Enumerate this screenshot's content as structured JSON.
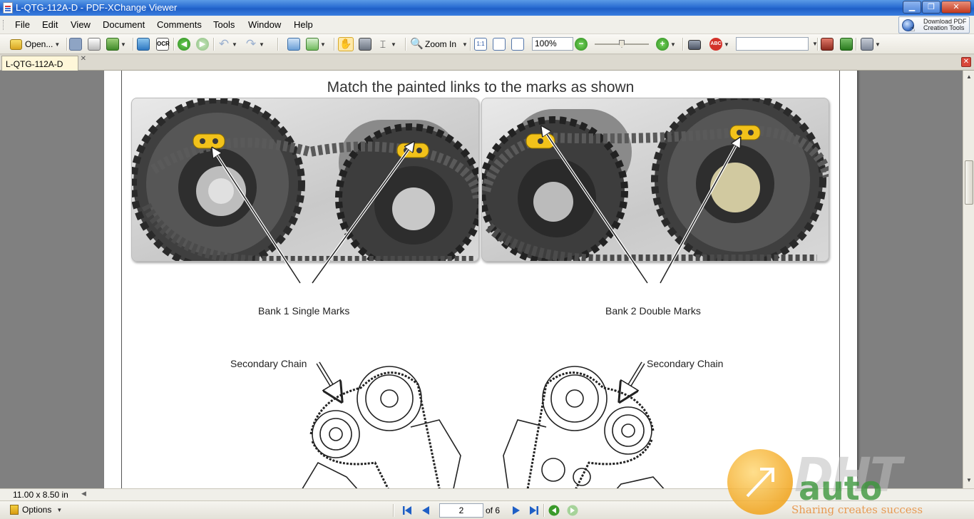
{
  "window": {
    "title": "L-QTG-112A-D - PDF-XChange Viewer",
    "min_glyph": "▁",
    "max_glyph": "❐",
    "close_glyph": "✕"
  },
  "menubar": {
    "items": [
      "File",
      "Edit",
      "View",
      "Document",
      "Comments",
      "Tools",
      "Window",
      "Help"
    ],
    "download_text": "Download PDF\nCreation Tools"
  },
  "toolbar": {
    "open_label": "Open...",
    "zoom_in_label": "Zoom In",
    "zoom_value": "100%",
    "ocr_label": "OCR",
    "fit_page_label": "1:1"
  },
  "tabs": {
    "document_tab": "L-QTG-112A-D",
    "tab_close_glyph": "✕",
    "close_doc_glyph": "✕"
  },
  "page": {
    "heading": "Match the painted links to the marks as shown",
    "bank1_caption": "Bank 1 Single Marks",
    "bank2_caption": "Bank 2 Double Marks",
    "secondary_left": "Secondary Chain",
    "secondary_right": "Secondary Chain"
  },
  "statusbar": {
    "page_size": "11.00 x 8.50 in"
  },
  "navbar": {
    "options_label": "Options",
    "current_page": "2",
    "page_total": "of 6"
  },
  "watermark": {
    "big": "DHT",
    "auto": "auto",
    "tagline": "Sharing creates success"
  },
  "colors": {
    "title_bar": "#2a6dd2",
    "viewer_bg": "#808080",
    "link_mark": "#f2c21a",
    "nav_blue": "#1f5fc6",
    "nav_green": "#3a9a2a"
  }
}
